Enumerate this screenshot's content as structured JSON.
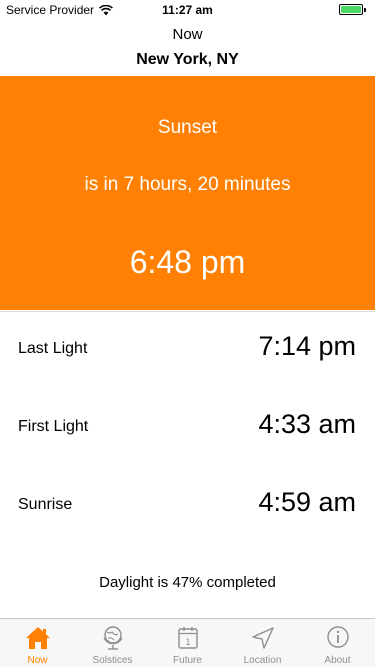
{
  "status_bar": {
    "carrier": "Service Provider",
    "time": "11:27 am"
  },
  "nav": {
    "title": "Now",
    "location": "New York, NY"
  },
  "hero": {
    "event": "Sunset",
    "countdown": "is in 7 hours, 20 minutes",
    "event_time": "6:48 pm",
    "color": "#ff8002"
  },
  "rows": [
    {
      "label": "Last Light",
      "value": "7:14 pm"
    },
    {
      "label": "First Light",
      "value": "4:33 am"
    },
    {
      "label": "Sunrise",
      "value": "4:59 am"
    }
  ],
  "daylight": {
    "text": "Daylight is 47% completed",
    "percent": 47
  },
  "tabs": [
    {
      "label": "Now",
      "icon": "house-icon",
      "active": true
    },
    {
      "label": "Solstices",
      "icon": "globe-icon",
      "active": false
    },
    {
      "label": "Future",
      "icon": "calendar-icon",
      "active": false,
      "badge": "1"
    },
    {
      "label": "Location",
      "icon": "location-arrow-icon",
      "active": false
    },
    {
      "label": "About",
      "icon": "info-icon",
      "active": false
    }
  ]
}
